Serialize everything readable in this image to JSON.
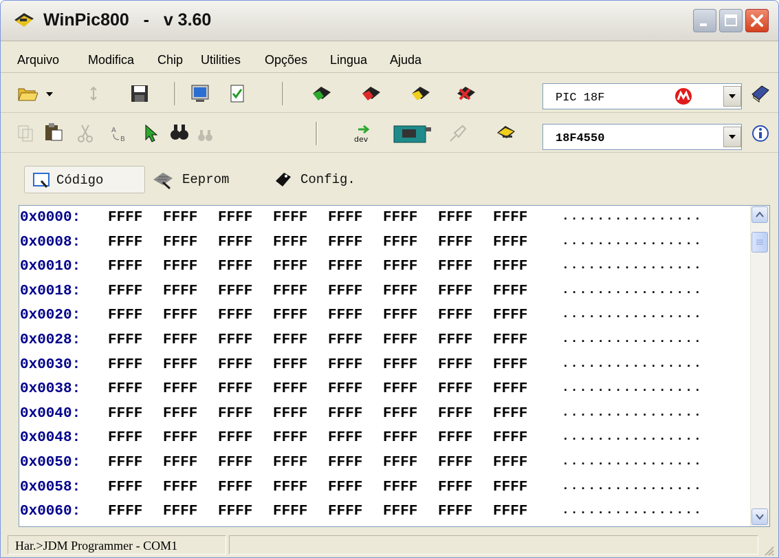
{
  "window": {
    "title": "WinPic800   -   v 3.60"
  },
  "menu": [
    "Arquivo",
    "Modifica",
    "Chip",
    "Utilities",
    "Opções",
    "Lingua",
    "Ajuda"
  ],
  "family_combo": {
    "value": "PIC 18F"
  },
  "device_combo": {
    "value": "18F4550"
  },
  "tabs": [
    {
      "label": "Código",
      "icon": "code-tab-icon"
    },
    {
      "label": "Eeprom",
      "icon": "eeprom-tab-icon"
    },
    {
      "label": "Config.",
      "icon": "config-tab-icon"
    }
  ],
  "hex": {
    "rows": [
      {
        "addr": "0x0000:",
        "words": [
          "FFFF",
          "FFFF",
          "FFFF",
          "FFFF",
          "FFFF",
          "FFFF",
          "FFFF",
          "FFFF"
        ],
        "ascii": "................"
      },
      {
        "addr": "0x0008:",
        "words": [
          "FFFF",
          "FFFF",
          "FFFF",
          "FFFF",
          "FFFF",
          "FFFF",
          "FFFF",
          "FFFF"
        ],
        "ascii": "................"
      },
      {
        "addr": "0x0010:",
        "words": [
          "FFFF",
          "FFFF",
          "FFFF",
          "FFFF",
          "FFFF",
          "FFFF",
          "FFFF",
          "FFFF"
        ],
        "ascii": "................"
      },
      {
        "addr": "0x0018:",
        "words": [
          "FFFF",
          "FFFF",
          "FFFF",
          "FFFF",
          "FFFF",
          "FFFF",
          "FFFF",
          "FFFF"
        ],
        "ascii": "................"
      },
      {
        "addr": "0x0020:",
        "words": [
          "FFFF",
          "FFFF",
          "FFFF",
          "FFFF",
          "FFFF",
          "FFFF",
          "FFFF",
          "FFFF"
        ],
        "ascii": "................"
      },
      {
        "addr": "0x0028:",
        "words": [
          "FFFF",
          "FFFF",
          "FFFF",
          "FFFF",
          "FFFF",
          "FFFF",
          "FFFF",
          "FFFF"
        ],
        "ascii": "................"
      },
      {
        "addr": "0x0030:",
        "words": [
          "FFFF",
          "FFFF",
          "FFFF",
          "FFFF",
          "FFFF",
          "FFFF",
          "FFFF",
          "FFFF"
        ],
        "ascii": "................"
      },
      {
        "addr": "0x0038:",
        "words": [
          "FFFF",
          "FFFF",
          "FFFF",
          "FFFF",
          "FFFF",
          "FFFF",
          "FFFF",
          "FFFF"
        ],
        "ascii": "................"
      },
      {
        "addr": "0x0040:",
        "words": [
          "FFFF",
          "FFFF",
          "FFFF",
          "FFFF",
          "FFFF",
          "FFFF",
          "FFFF",
          "FFFF"
        ],
        "ascii": "................"
      },
      {
        "addr": "0x0048:",
        "words": [
          "FFFF",
          "FFFF",
          "FFFF",
          "FFFF",
          "FFFF",
          "FFFF",
          "FFFF",
          "FFFF"
        ],
        "ascii": "................"
      },
      {
        "addr": "0x0050:",
        "words": [
          "FFFF",
          "FFFF",
          "FFFF",
          "FFFF",
          "FFFF",
          "FFFF",
          "FFFF",
          "FFFF"
        ],
        "ascii": "................"
      },
      {
        "addr": "0x0058:",
        "words": [
          "FFFF",
          "FFFF",
          "FFFF",
          "FFFF",
          "FFFF",
          "FFFF",
          "FFFF",
          "FFFF"
        ],
        "ascii": "................"
      },
      {
        "addr": "0x0060:",
        "words": [
          "FFFF",
          "FFFF",
          "FFFF",
          "FFFF",
          "FFFF",
          "FFFF",
          "FFFF",
          "FFFF"
        ],
        "ascii": "................"
      }
    ]
  },
  "status": {
    "text": "Har.>JDM Programmer - COM1"
  },
  "colors": {
    "address": "#00008b",
    "accent": "#7f9db9"
  }
}
